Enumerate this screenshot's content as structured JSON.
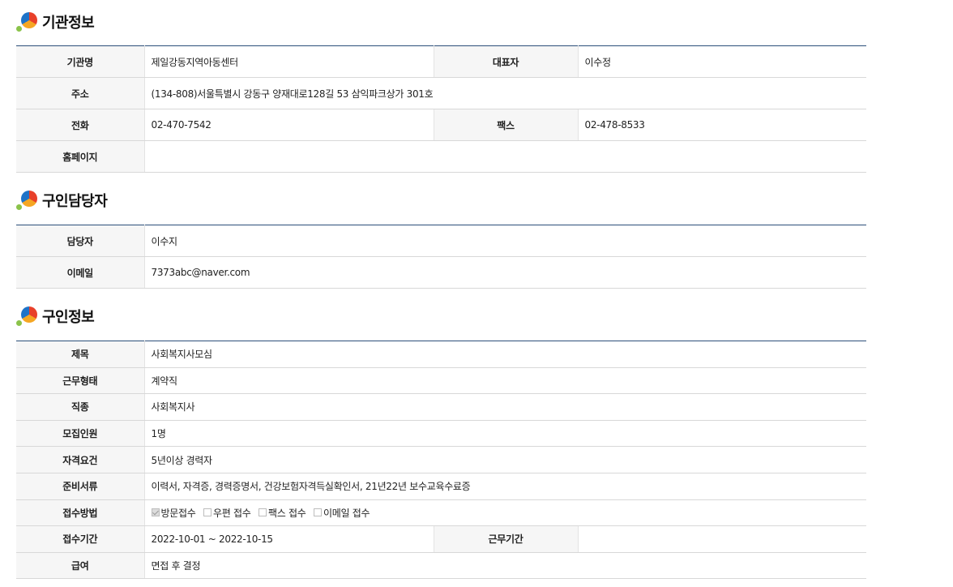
{
  "sections": {
    "org": {
      "title": "기관정보",
      "rows": {
        "name_label": "기관명",
        "name_value": "제일강동지역아동센터",
        "ceo_label": "대표자",
        "ceo_value": "이수정",
        "address_label": "주소",
        "address_value": "(134-808)서울특별시 강동구 양재대로128길 53 삼익파크상가 301호",
        "phone_label": "전화",
        "phone_value": "02-470-7542",
        "fax_label": "팩스",
        "fax_value": "02-478-8533",
        "homepage_label": "홈페이지",
        "homepage_value": ""
      }
    },
    "contact": {
      "title": "구인담당자",
      "rows": {
        "manager_label": "담당자",
        "manager_value": "이수지",
        "email_label": "이메일",
        "email_value": "7373abc@naver.com"
      }
    },
    "job": {
      "title": "구인정보",
      "rows": {
        "subject_label": "제목",
        "subject_value": "사회복지사모심",
        "worktype_label": "근무형태",
        "worktype_value": "계약직",
        "occupation_label": "직종",
        "occupation_value": "사회복지사",
        "headcount_label": "모집인원",
        "headcount_value": "1명",
        "qualification_label": "자격요건",
        "qualification_value": "5년이상 경력자",
        "documents_label": "준비서류",
        "documents_value": "이력서, 자격증, 경력증명서, 건강보험자격득실확인서, 21년22년 보수교육수료증",
        "method_label": "접수방법",
        "methods": [
          {
            "label": "방문접수",
            "checked": true
          },
          {
            "label": "우편 접수",
            "checked": false
          },
          {
            "label": "팩스 접수",
            "checked": false
          },
          {
            "label": "이메일 접수",
            "checked": false
          }
        ],
        "period_label": "접수기간",
        "period_value": "2022-10-01 ~ 2022-10-15",
        "workperiod_label": "근무기간",
        "workperiod_value": "",
        "salary_label": "급여",
        "salary_value": "면접 후 결정"
      }
    }
  },
  "colors": {
    "table_top_border": "#2c4f7a",
    "header_bg": "#f6f6f6"
  }
}
